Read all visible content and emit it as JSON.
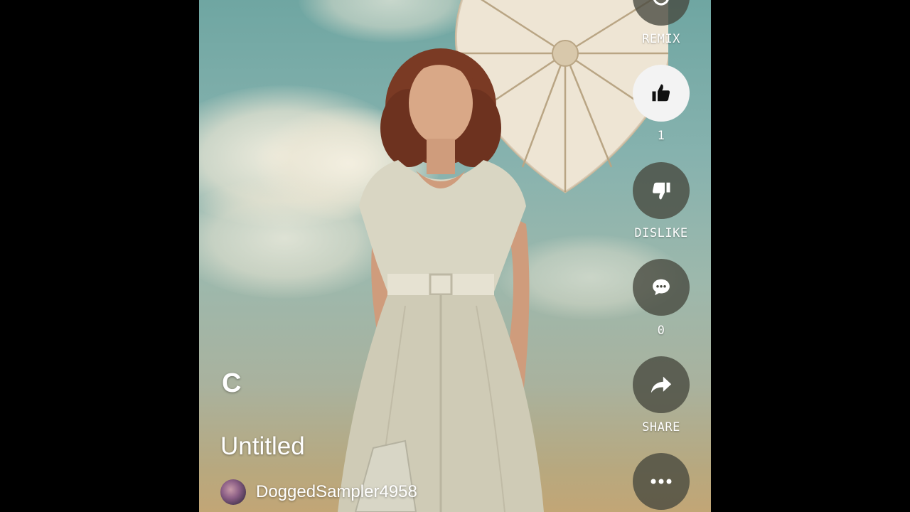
{
  "actions": {
    "remix_label": "REMIX",
    "like_count": "1",
    "dislike_label": "DISLIKE",
    "comment_count": "0",
    "share_label": "SHARE"
  },
  "post": {
    "channel_letter": "C",
    "title": "Untitled",
    "author": "DoggedSampler4958"
  },
  "colors": {
    "sky": "#86b2ae",
    "button_bg": "#46483e",
    "button_active_bg": "#f3f3f3"
  },
  "icons": [
    "remix-icon",
    "thumbs-up-icon",
    "thumbs-down-icon",
    "comment-icon",
    "share-icon",
    "more-icon"
  ]
}
